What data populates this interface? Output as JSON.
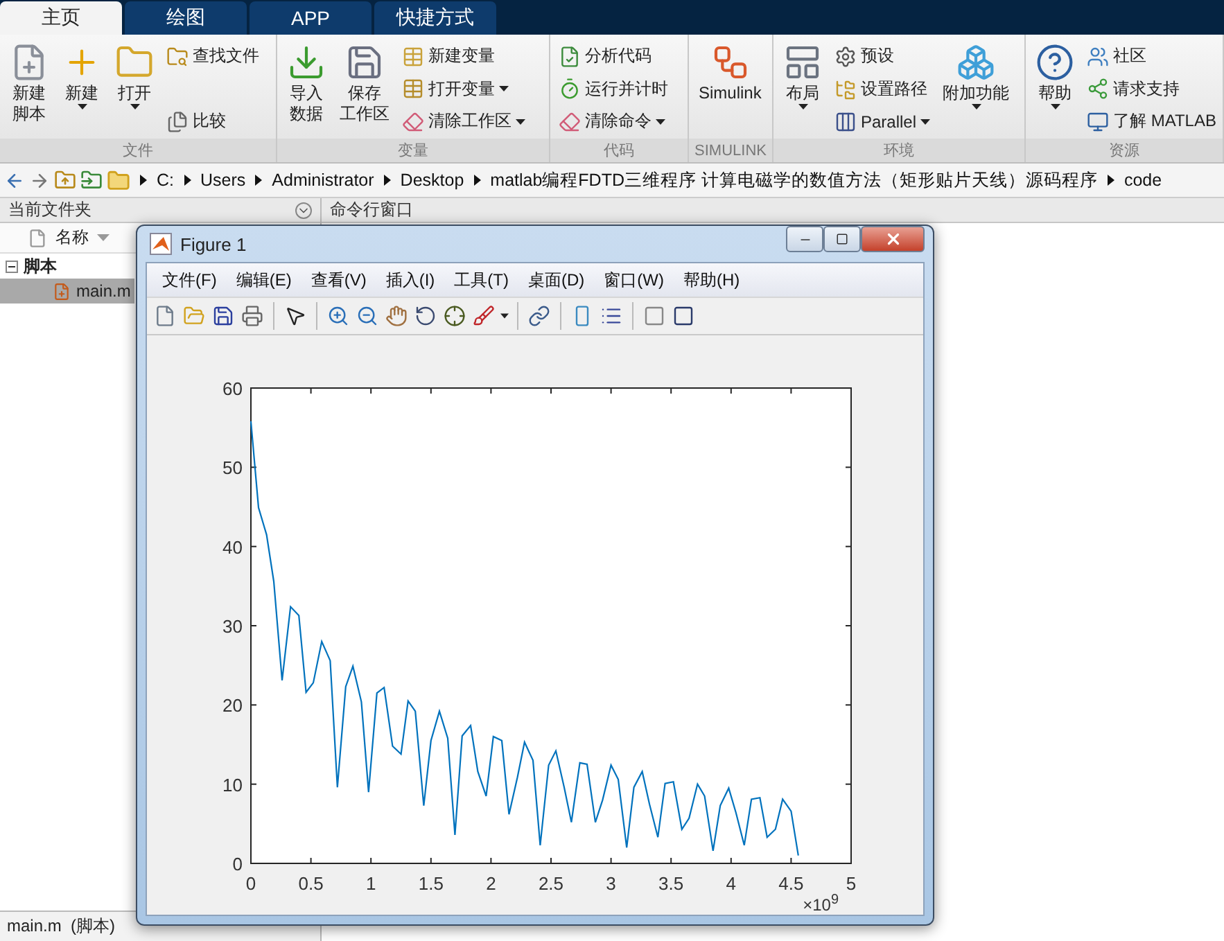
{
  "tabs": [
    {
      "label": "主页",
      "selected": true
    },
    {
      "label": "绘图",
      "selected": false
    },
    {
      "label": "APP",
      "selected": false
    },
    {
      "label": "快捷方式",
      "selected": false
    }
  ],
  "ribbon": {
    "groups": [
      {
        "label": "文件",
        "columns": [
          {
            "kind": "large",
            "lines": [
              "新建",
              "脚本"
            ],
            "dropdown": false
          },
          {
            "kind": "large",
            "lines": [
              "新建"
            ],
            "dropdown": true
          },
          {
            "kind": "large",
            "lines": [
              "打开"
            ],
            "dropdown": true
          },
          {
            "kind": "stack",
            "items": [
              {
                "label": "查找文件",
                "dropdown": false
              },
              {
                "label": "比较",
                "dropdown": false
              }
            ]
          }
        ]
      },
      {
        "label": "变量",
        "columns": [
          {
            "kind": "large",
            "lines": [
              "导入",
              "数据"
            ],
            "dropdown": false
          },
          {
            "kind": "large",
            "lines": [
              "保存",
              "工作区"
            ],
            "dropdown": false
          },
          {
            "kind": "stack",
            "items": [
              {
                "label": "新建变量",
                "dropdown": false
              },
              {
                "label": "打开变量",
                "dropdown": true
              },
              {
                "label": "清除工作区",
                "dropdown": true
              }
            ]
          }
        ]
      },
      {
        "label": "代码",
        "columns": [
          {
            "kind": "stack",
            "items": [
              {
                "label": "分析代码",
                "dropdown": false
              },
              {
                "label": "运行并计时",
                "dropdown": false
              },
              {
                "label": "清除命令",
                "dropdown": true
              }
            ]
          }
        ]
      },
      {
        "label": "SIMULINK",
        "columns": [
          {
            "kind": "large",
            "lines": [
              "Simulink"
            ],
            "dropdown": false
          }
        ]
      },
      {
        "label": "环境",
        "columns": [
          {
            "kind": "large",
            "lines": [
              "布局"
            ],
            "dropdown": true
          },
          {
            "kind": "stack",
            "items": [
              {
                "label": "预设",
                "dropdown": false
              },
              {
                "label": "设置路径",
                "dropdown": false
              },
              {
                "label": "Parallel",
                "dropdown": true
              }
            ]
          },
          {
            "kind": "large",
            "lines": [
              "附加功能"
            ],
            "dropdown": true
          }
        ]
      },
      {
        "label": "资源",
        "columns": [
          {
            "kind": "large",
            "lines": [
              "帮助"
            ],
            "dropdown": true
          },
          {
            "kind": "stack",
            "items": [
              {
                "label": "社区",
                "dropdown": false
              },
              {
                "label": "请求支持",
                "dropdown": false
              },
              {
                "label": "了解 MATLAB",
                "dropdown": false
              }
            ]
          }
        ]
      }
    ]
  },
  "address": {
    "segments": [
      "C:",
      "Users",
      "Administrator",
      "Desktop",
      "matlab编程FDTD三维程序 计算电磁学的数值方法（矩形贴片天线）源码程序",
      "code"
    ]
  },
  "file_panel": {
    "title": "当前文件夹",
    "column": "名称",
    "tree": [
      {
        "label": "脚本",
        "expanded": true,
        "children": [
          {
            "label": "main.m",
            "selected": true
          }
        ]
      }
    ],
    "footer": "main.m  (脚本)"
  },
  "command_window": {
    "title": "命令行窗口"
  },
  "figure": {
    "title": "Figure 1",
    "menu": [
      "文件(F)",
      "编辑(E)",
      "查看(V)",
      "插入(I)",
      "工具(T)",
      "桌面(D)",
      "窗口(W)",
      "帮助(H)"
    ],
    "exponent": "×10$^{9}$",
    "chart_data": {
      "type": "line",
      "xlim": [
        0,
        5
      ],
      "ylim": [
        0,
        60
      ],
      "xticks": [
        0,
        0.5,
        1,
        1.5,
        2,
        2.5,
        3,
        3.5,
        4,
        4.5,
        5
      ],
      "yticks": [
        0,
        10,
        20,
        30,
        40,
        50,
        60
      ],
      "x": [
        0,
        0.064,
        0.13,
        0.19,
        0.26,
        0.33,
        0.4,
        0.46,
        0.52,
        0.59,
        0.66,
        0.72,
        0.79,
        0.85,
        0.92,
        0.98,
        1.05,
        1.11,
        1.18,
        1.25,
        1.31,
        1.37,
        1.44,
        1.5,
        1.57,
        1.64,
        1.7,
        1.76,
        1.83,
        1.89,
        1.96,
        2.02,
        2.09,
        2.15,
        2.22,
        2.28,
        2.35,
        2.41,
        2.48,
        2.54,
        2.61,
        2.67,
        2.74,
        2.8,
        2.87,
        2.93,
        3,
        3.06,
        3.13,
        3.19,
        3.26,
        3.32,
        3.39,
        3.45,
        3.52,
        3.59,
        3.65,
        3.72,
        3.78,
        3.85,
        3.91,
        3.98,
        4.04,
        4.11,
        4.17,
        4.24,
        4.3,
        4.37,
        4.43,
        4.5,
        4.56
      ],
      "series": [
        {
          "color": "#0072bd",
          "values": [
            55.8,
            44.9,
            41.5,
            35.6,
            23.1,
            32.4,
            31.3,
            21.6,
            22.8,
            28,
            25.6,
            9.6,
            22.3,
            24.9,
            20.4,
            9,
            21.5,
            22.2,
            14.8,
            13.8,
            20.5,
            19.2,
            7.3,
            15.5,
            19.2,
            15.8,
            3.6,
            16.1,
            17.4,
            11.6,
            8.5,
            16,
            15.5,
            6.2,
            10.9,
            15.3,
            13,
            2.3,
            12.4,
            14.2,
            9.6,
            5.2,
            12.7,
            12.5,
            5.2,
            8,
            12.4,
            10.6,
            2,
            9.6,
            11.6,
            7.5,
            3.3,
            10.1,
            10.3,
            4.3,
            5.7,
            10,
            8.5,
            1.6,
            7.3,
            9.5,
            6.4,
            2.3,
            8.1,
            8.3,
            3.3,
            4.3,
            8.1,
            6.6,
            1
          ]
        }
      ]
    }
  }
}
